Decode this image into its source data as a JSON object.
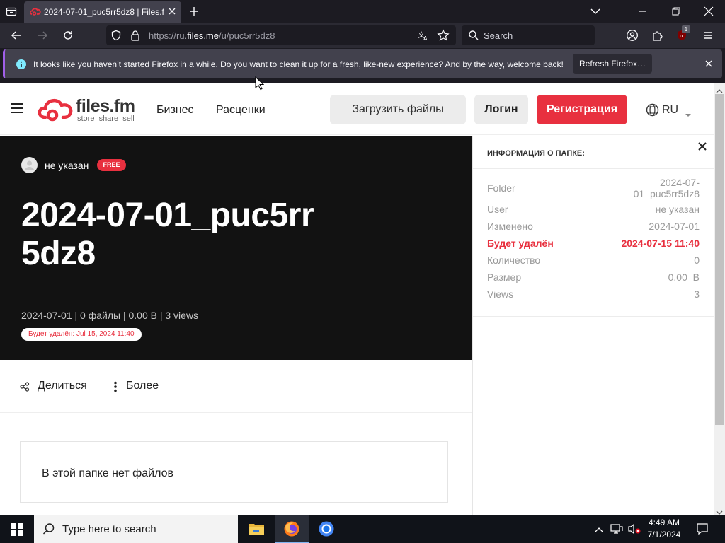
{
  "browser": {
    "tab_title": "2024-07-01_puc5rr5dz8 | Files.fm",
    "url_prefix": "https://ru.",
    "url_domain": "files.me",
    "url_path": "/u/puc5rr5dz8",
    "search_placeholder": "Search",
    "extension_badge": "1",
    "notification": "It looks like you haven’t started Firefox in a while. Do you want to clean it up for a fresh, like-new experience? And by the way, welcome back!",
    "refresh_button": "Refresh Firefox…"
  },
  "site": {
    "logo_name": "files.fm",
    "logo_tagline": "store  share  sell",
    "nav": [
      "Бизнес",
      "Расценки"
    ],
    "upload_button": "Загрузить файлы",
    "login_button": "Логин",
    "register_button": "Регистрация",
    "language": "RU",
    "accent_color": "#e8303f"
  },
  "folder": {
    "owner": "не указан",
    "plan_badge": "FREE",
    "title": "2024-07-01_puc5rr5dz8",
    "meta": "2024-07-01 | 0 файлы | 0.00  B | 3 views",
    "delete_badge": "Будет удалён: Jul 15, 2024 11:40",
    "share_label": "Делиться",
    "more_label": "Более",
    "empty_message": "В этой папке нет файлов"
  },
  "info": {
    "heading": "ИНФОРМАЦИЯ О ПАПКЕ:",
    "folder_label": "Folder",
    "folder_value_line1": "2024-07-",
    "folder_value_line2": "01_puc5rr5dz8",
    "user_label": "User",
    "user_value": "не указан",
    "changed_label": "Изменено",
    "changed_value": "2024-07-01",
    "delete_label": "Будет удалён",
    "delete_value": "2024-07-15 11:40",
    "count_label": "Количество",
    "count_value": "0",
    "size_label": "Размер",
    "size_value": "0.00  B",
    "views_label": "Views",
    "views_value": "3"
  },
  "taskbar": {
    "search_placeholder": "Type here to search",
    "time": "4:49 AM",
    "date": "7/1/2024"
  }
}
